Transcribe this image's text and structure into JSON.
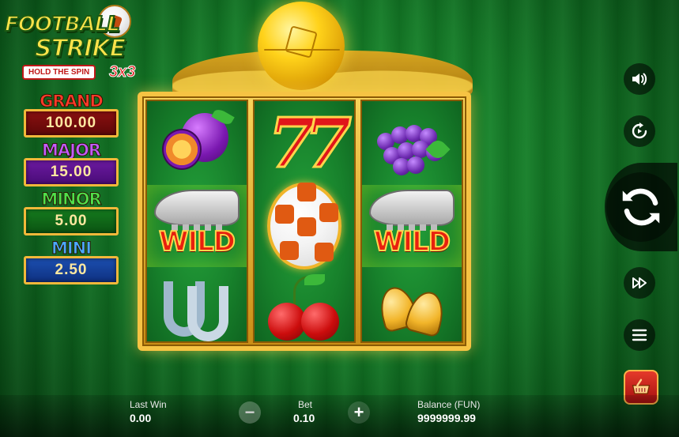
{
  "game": {
    "logo_line1": "FOOTBALL",
    "logo_line2": "STRIKE",
    "logo_sub": "HOLD THE SPIN",
    "logo_variant": "3x3"
  },
  "jackpots": [
    {
      "name": "GRAND",
      "value": "100.00",
      "color": "#ff3a2a"
    },
    {
      "name": "MAJOR",
      "value": "15.00",
      "color": "#c35cff"
    },
    {
      "name": "MINOR",
      "value": "5.00",
      "color": "#4fe04a"
    },
    {
      "name": "MINI",
      "value": "2.50",
      "color": "#4aa8ff"
    }
  ],
  "reels": [
    [
      "plum-icon",
      "boot-wild-icon",
      "horseshoe-icon"
    ],
    [
      "double-seven-icon",
      "football-icon",
      "cherries-icon"
    ],
    [
      "grapes-icon",
      "boot-wild-icon",
      "bells-icon"
    ]
  ],
  "symbols": {
    "sevens_text": "77",
    "wild_text": "WILD"
  },
  "controls": {
    "sound_icon": "speaker-icon",
    "autoplay_icon": "replay-icon",
    "spin_icon": "spin-arrows-icon",
    "turbo_icon": "fast-forward-icon",
    "menu_icon": "hamburger-menu-icon",
    "buy_icon": "shopping-basket-icon"
  },
  "bottom": {
    "last_win_label": "Last Win",
    "last_win_value": "0.00",
    "bet_label": "Bet",
    "bet_value": "0.10",
    "minus_label": "−",
    "plus_label": "+",
    "balance_label": "Balance (FUN)",
    "balance_value": "9999999.99"
  }
}
